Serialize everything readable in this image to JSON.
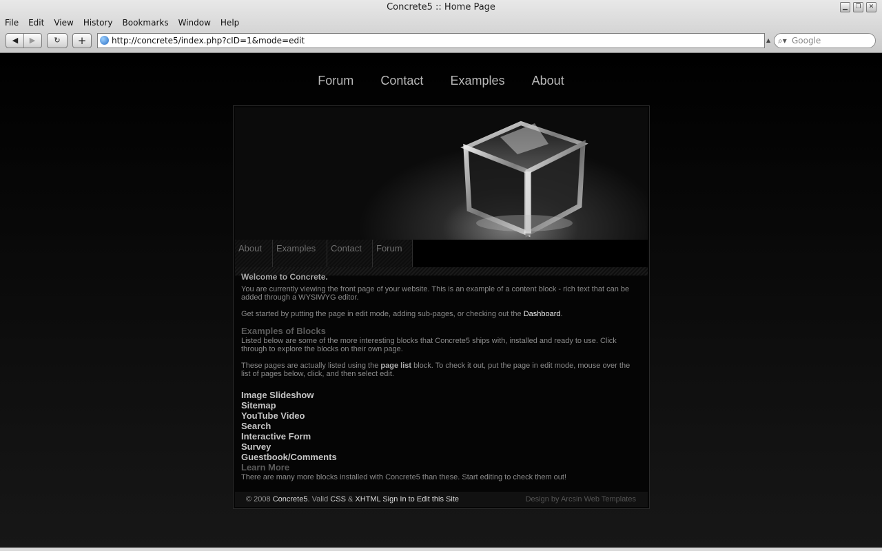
{
  "window": {
    "title": "Concrete5 :: Home Page",
    "controls": [
      "minimize-icon",
      "restore-icon",
      "close-icon"
    ]
  },
  "menubar": [
    "File",
    "Edit",
    "View",
    "History",
    "Bookmarks",
    "Window",
    "Help"
  ],
  "toolbar": {
    "back_icon": "back-arrow-icon",
    "forward_icon": "forward-arrow-icon",
    "reload_icon": "reload-icon",
    "add_bookmark_icon": "plus-icon",
    "url": "http://concrete5/index.php?cID=1&mode=edit",
    "search_placeholder": "Google"
  },
  "site": {
    "top_nav": [
      "Forum",
      "Contact",
      "Examples",
      "About"
    ],
    "sub_nav": [
      "About",
      "Examples",
      "Contact",
      "Forum"
    ],
    "welcome_title": "Welcome to Concrete.",
    "welcome_text": "You are currently viewing the front page of your website. This is an example of a content block - rich text that can be added through a WYSIWYG editor.",
    "get_started_text": "Get started by putting the page in edit mode, adding sub-pages, or checking out the",
    "dashboard_link": "Dashboard",
    "get_started_end": ".",
    "blocks_title": "Examples of Blocks",
    "blocks_text": "Listed below are some of the more interesting blocks that Concrete5 ships with, installed and ready to use. Click through to explore the blocks on their own page.",
    "page_list_pre": "These pages are actually listed using the",
    "page_list_bold": "page list",
    "page_list_post": "block. To check it out, put the page in edit mode, mouse over the list of pages below, click, and then select edit.",
    "page_links": [
      "Image Slideshow",
      "Sitemap",
      "YouTube Video",
      "Search",
      "Interactive Form",
      "Survey",
      "Guestbook/Comments"
    ],
    "learn_more_title": "Learn More",
    "learn_more_text": "There are many more blocks installed with Concrete5 than these. Start editing to check them out!",
    "footer": {
      "copyright": "© 2008",
      "concrete5_link": "Concrete5",
      "valid_text": ". Valid",
      "css_link": "CSS",
      "amp": "&",
      "xhtml_link": "XHTML",
      "sign_in_link": "Sign In to Edit this Site",
      "credit": "Design by Arcsin Web Templates"
    }
  }
}
